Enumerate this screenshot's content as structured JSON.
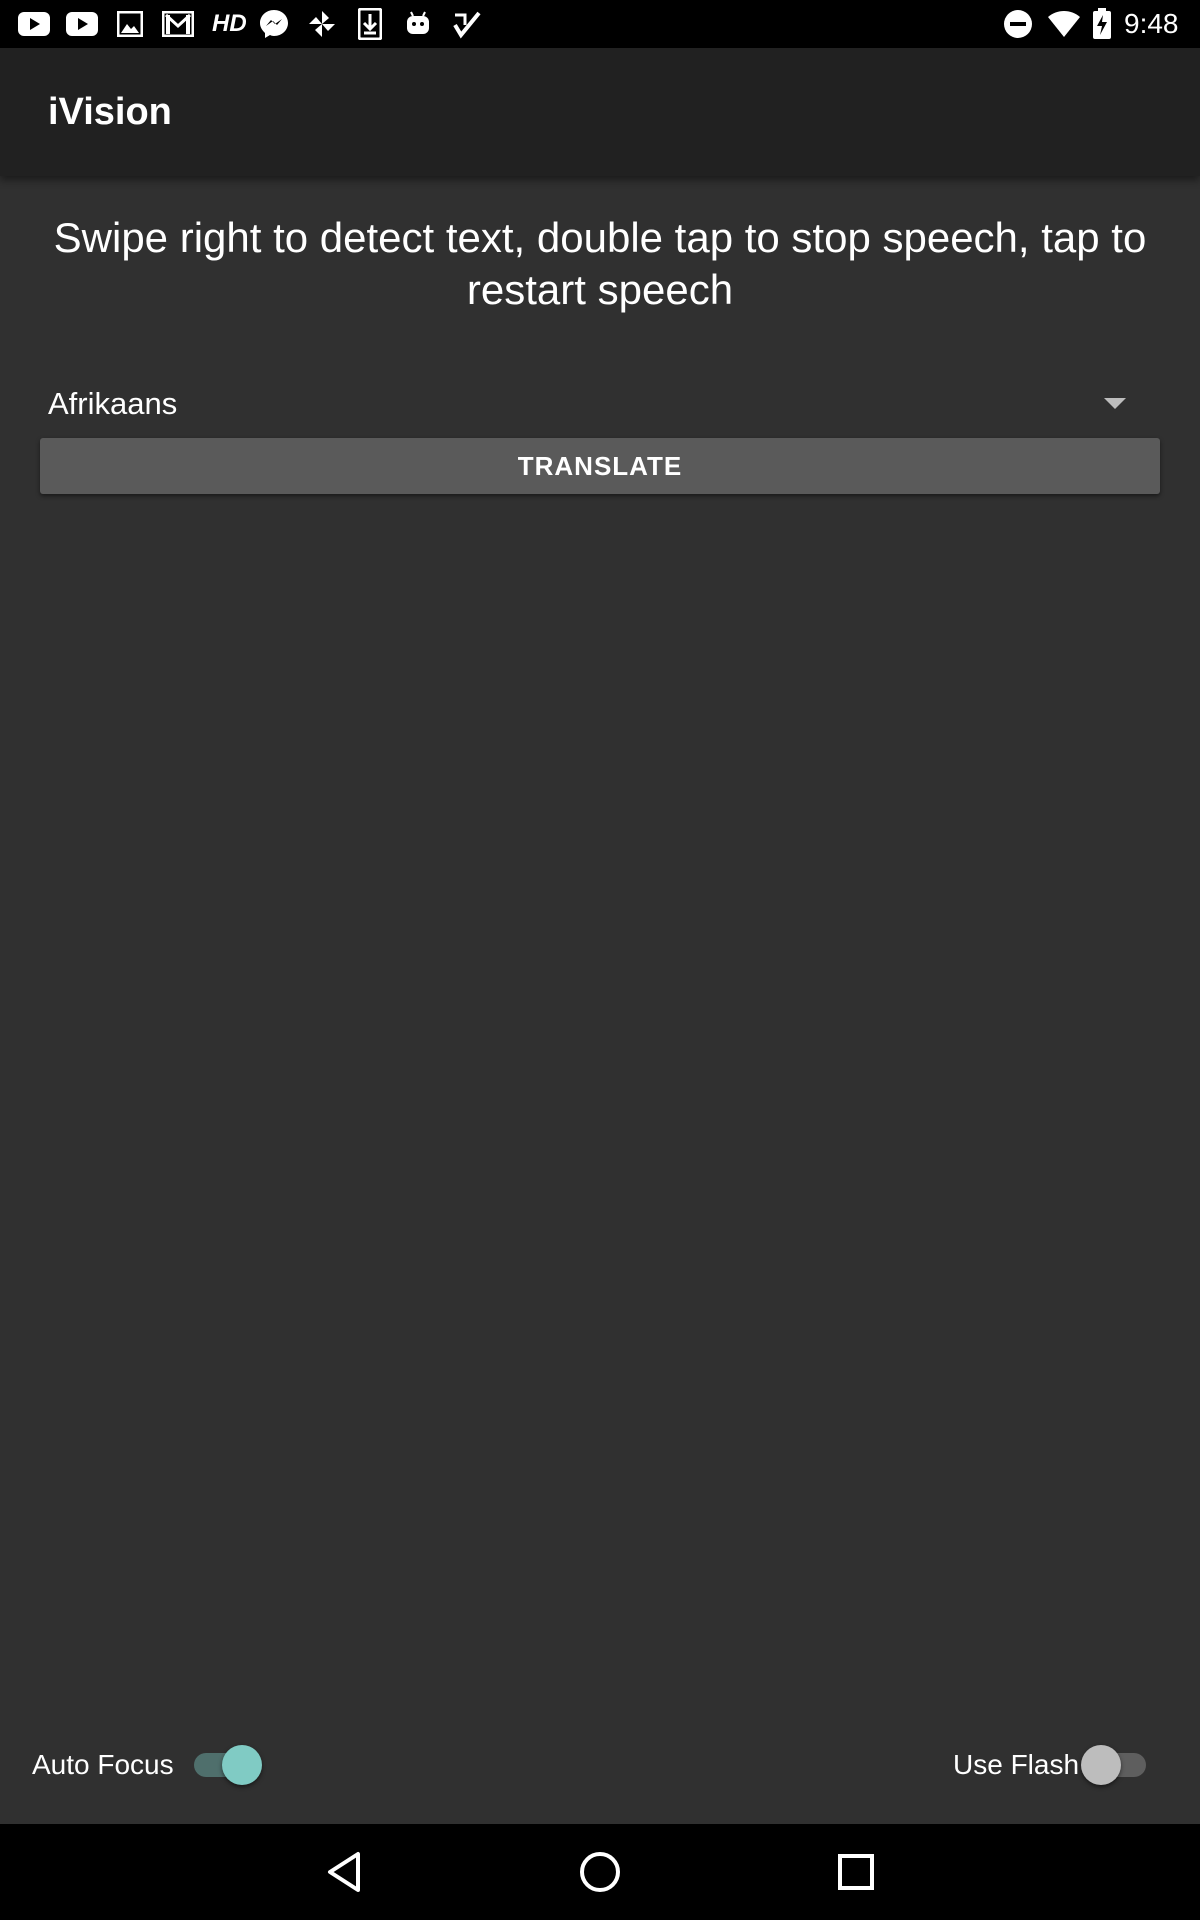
{
  "status_bar": {
    "time": "9:48",
    "hd_label": "HD",
    "notification_icons": [
      "youtube-icon",
      "youtube-icon",
      "image-icon",
      "gmail-icon",
      "hd-icon",
      "messenger-icon",
      "pinwheel-icon",
      "download-icon",
      "android-icon",
      "task-check-icon"
    ],
    "system_icons": [
      "do-not-disturb-icon",
      "wifi-icon",
      "battery-charging-icon"
    ]
  },
  "app_bar": {
    "title": "iVision"
  },
  "main": {
    "instructions": "Swipe right to detect text, double tap to stop speech, tap to restart speech",
    "language_spinner": {
      "selected": "Afrikaans"
    },
    "translate_button_label": "TRANSLATE"
  },
  "bottom_controls": {
    "auto_focus": {
      "label": "Auto Focus",
      "on": true
    },
    "use_flash": {
      "label": "Use Flash",
      "on": false
    }
  },
  "colors": {
    "background": "#303030",
    "app_bar": "#212121",
    "button": "#5a5a5a",
    "switch_on_thumb": "#80cbc4",
    "switch_on_track": "#4f6f6c",
    "switch_off_thumb": "#bdbdbd",
    "switch_off_track": "#5e5e5e"
  },
  "nav_bar": {
    "icons": [
      "back-icon",
      "home-icon",
      "recents-icon"
    ]
  }
}
